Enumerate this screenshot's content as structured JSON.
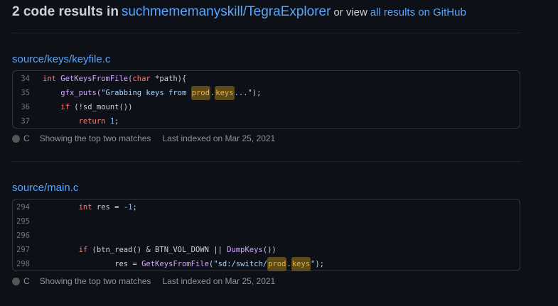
{
  "header": {
    "count_text": "2 code results in",
    "repo": "suchmememanyskill/TegraExplorer",
    "or_view": "or view",
    "all_results_link": "all results on GitHub"
  },
  "results": [
    {
      "file": "source/keys/keyfile.c",
      "language": "C",
      "language_color": "#555555",
      "matches_text": "Showing the top two matches",
      "indexed_text": "Last indexed on Mar 25, 2021",
      "line_numbers": [
        "34",
        "35",
        "36",
        "37"
      ],
      "tokens": {
        "l34_a": "int",
        "l34_b": " GetKeysFromFile(",
        "l34_c": "char",
        "l34_d": " *path){",
        "l35_a": "gfx_puts(",
        "l35_b": "\"Grabbing keys from ",
        "l35_c": "prod",
        "l35_d": ".",
        "l35_e": "keys",
        "l35_f": "...\"",
        "l35_g": ");",
        "l36_a": "if",
        "l36_b": " (!sd_mount())",
        "l37_a": "return",
        "l37_b": "1",
        "l37_c": ";"
      }
    },
    {
      "file": "source/main.c",
      "language": "C",
      "language_color": "#555555",
      "matches_text": "Showing the top two matches",
      "indexed_text": "Last indexed on Mar 25, 2021",
      "line_numbers": [
        "294",
        "295",
        "296",
        "297",
        "298"
      ],
      "tokens": {
        "l294_a": "int",
        "l294_b": " res = ",
        "l294_c": "-1",
        "l294_d": ";",
        "l297_a": "if",
        "l297_b": " (btn_read() & BTN_VOL_DOWN || ",
        "l297_c": "DumpKeys",
        "l297_d": "())",
        "l298_a": "res = ",
        "l298_b": "GetKeysFromFile",
        "l298_c": "(",
        "l298_d": "\"sd:/switch/",
        "l298_e": "prod",
        "l298_f": ".",
        "l298_g": "keys",
        "l298_h": "\"",
        "l298_i": ");"
      }
    }
  ]
}
